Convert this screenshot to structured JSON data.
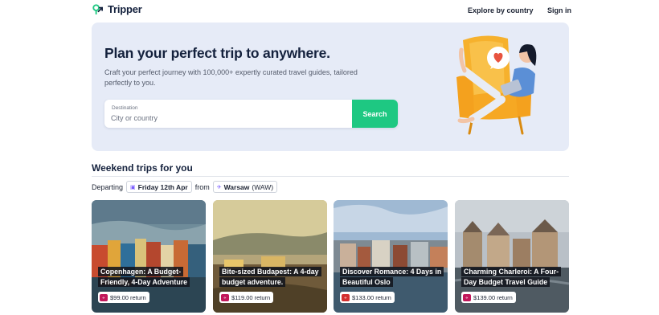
{
  "brand": {
    "name": "Tripper",
    "color": "#1ec882"
  },
  "nav": {
    "explore": "Explore by country",
    "signin": "Sign in"
  },
  "hero": {
    "title": "Plan your perfect trip to anywhere.",
    "subtitle": "Craft your perfect journey with 100,000+ expertly curated travel guides, tailored perfectly to you.",
    "destination_label": "Destination",
    "destination_placeholder": "City or country",
    "destination_value": "",
    "search_label": "Search"
  },
  "weekend": {
    "title": "Weekend trips for you",
    "departing_label": "Departing",
    "date": "Friday 12th Apr",
    "from_label": "from",
    "origin_city": "Warsaw",
    "origin_code": "(WAW)"
  },
  "cards": [
    {
      "title": "Copenhagen: A Budget-Friendly, 4-Day Adventure",
      "price": "$99.00 return",
      "carrier_icon": "airline-logo-icon"
    },
    {
      "title": "Bite-sized Budapest: A 4-day budget adventure.",
      "price": "$119.00 return",
      "carrier_icon": "airline-logo-icon"
    },
    {
      "title": "Discover Romance: 4 Days in Beautiful Oslo",
      "price": "$133.00 return",
      "carrier_icon": "airline-logo-icon"
    },
    {
      "title": "Charming Charleroi: A Four-Day Budget Travel Guide",
      "price": "$139.00 return",
      "carrier_icon": "airline-logo-icon"
    }
  ]
}
